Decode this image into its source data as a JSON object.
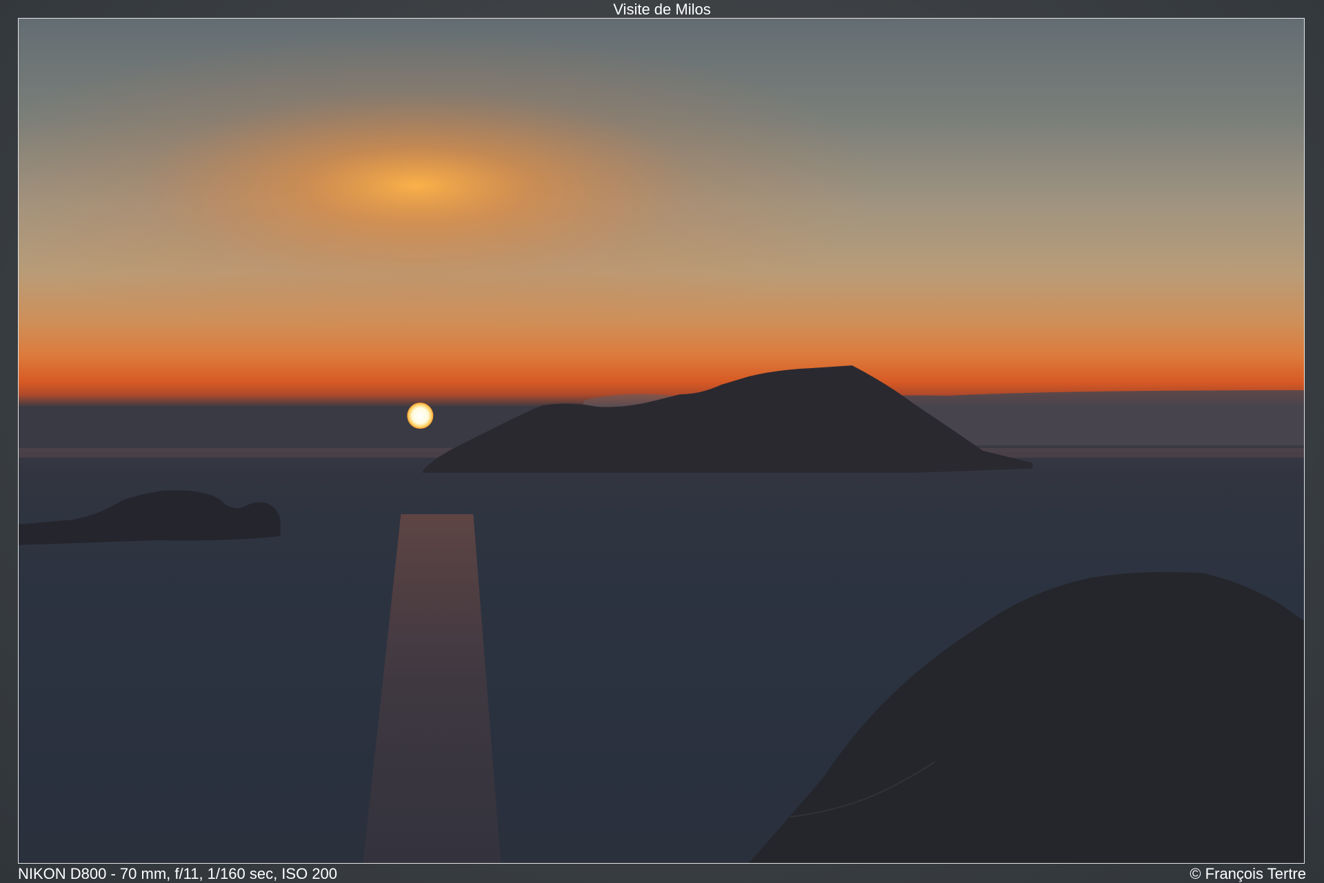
{
  "title": "Visite de Milos",
  "camera_info": "NIKON D800 - 70 mm, f/11, 1/160 sec, ISO 200",
  "copyright": "© François Tertre",
  "colors": {
    "sky_top": "#636d72",
    "sky_mid": "#b39c7d",
    "sky_glow": "#ee8a3a",
    "horizon": "#d9541e",
    "sun": "#fffbe6",
    "sea": "#2b3240",
    "silhouette": "#23252c"
  }
}
